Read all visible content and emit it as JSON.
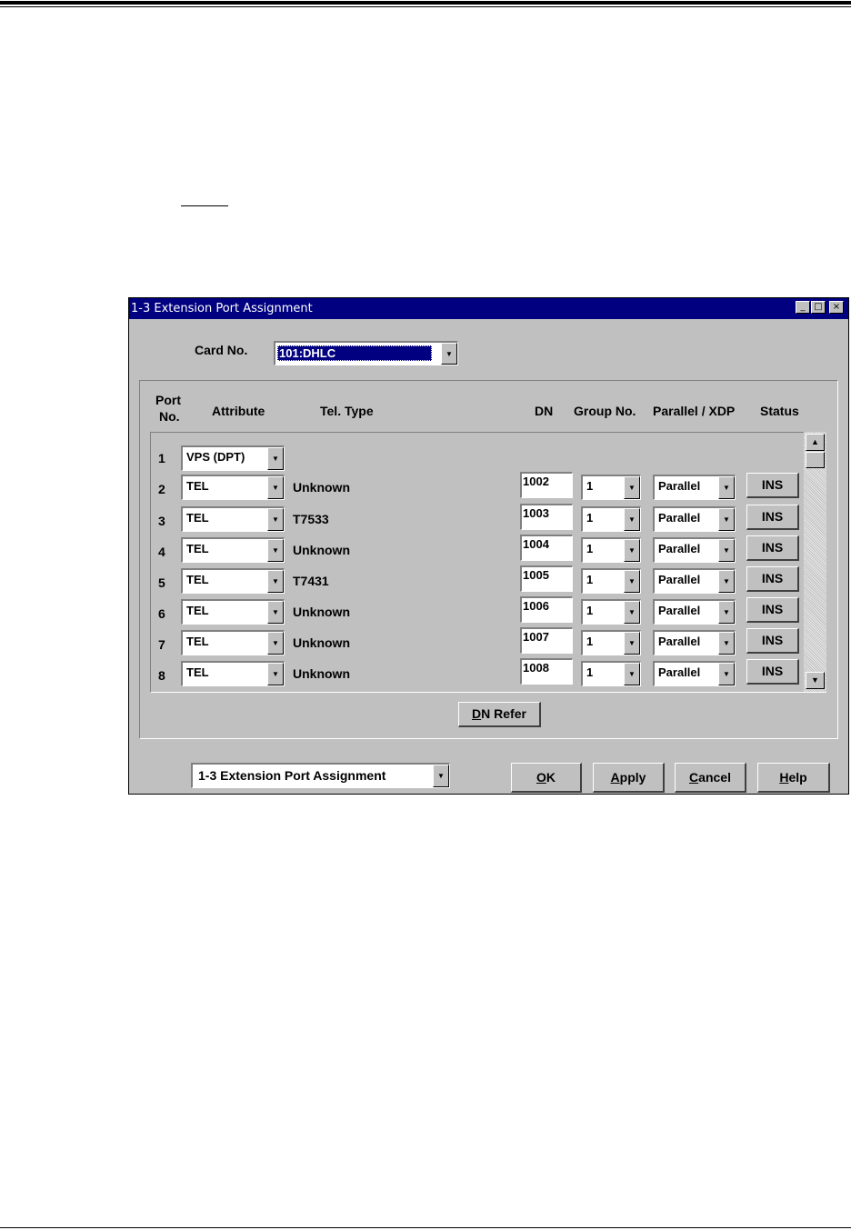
{
  "window": {
    "title": "1-3 Extension Port Assignment",
    "buttons": {
      "minimize": "_",
      "maximize": "□",
      "close": "×"
    }
  },
  "card": {
    "label": "Card No.",
    "value": "101:DHLC"
  },
  "headers": {
    "port_no_line1": "Port",
    "port_no_line2": "No.",
    "attribute": "Attribute",
    "tel_type": "Tel. Type",
    "dn": "DN",
    "group_no": "Group No.",
    "parallel_xdp": "Parallel / XDP",
    "status": "Status"
  },
  "rows": [
    {
      "port": "1",
      "attribute": "VPS (DPT)",
      "tel_type": "",
      "dn": "",
      "group": "",
      "parallel": "",
      "status": ""
    },
    {
      "port": "2",
      "attribute": "TEL",
      "tel_type": "Unknown",
      "dn": "1002",
      "group": "1",
      "parallel": "Parallel",
      "status": "INS"
    },
    {
      "port": "3",
      "attribute": "TEL",
      "tel_type": "T7533",
      "dn": "1003",
      "group": "1",
      "parallel": "Parallel",
      "status": "INS"
    },
    {
      "port": "4",
      "attribute": "TEL",
      "tel_type": "Unknown",
      "dn": "1004",
      "group": "1",
      "parallel": "Parallel",
      "status": "INS"
    },
    {
      "port": "5",
      "attribute": "TEL",
      "tel_type": "T7431",
      "dn": "1005",
      "group": "1",
      "parallel": "Parallel",
      "status": "INS"
    },
    {
      "port": "6",
      "attribute": "TEL",
      "tel_type": "Unknown",
      "dn": "1006",
      "group": "1",
      "parallel": "Parallel",
      "status": "INS"
    },
    {
      "port": "7",
      "attribute": "TEL",
      "tel_type": "Unknown",
      "dn": "1007",
      "group": "1",
      "parallel": "Parallel",
      "status": "INS"
    },
    {
      "port": "8",
      "attribute": "TEL",
      "tel_type": "Unknown",
      "dn": "1008",
      "group": "1",
      "parallel": "Parallel",
      "status": "INS"
    }
  ],
  "dn_refer": {
    "mnemonic": "D",
    "rest": "N Refer"
  },
  "footer": {
    "page_select": "1-3 Extension Port Assignment",
    "ok": {
      "mnemonic": "O",
      "rest": "K"
    },
    "apply": {
      "mnemonic": "A",
      "rest": "pply"
    },
    "cancel": {
      "mnemonic": "C",
      "rest": "ancel"
    },
    "help": {
      "mnemonic": "H",
      "rest": "elp"
    }
  },
  "icons": {
    "dropdown": "chevron-down-icon",
    "scroll_up": "arrow-up-icon",
    "scroll_down": "arrow-down-icon"
  }
}
